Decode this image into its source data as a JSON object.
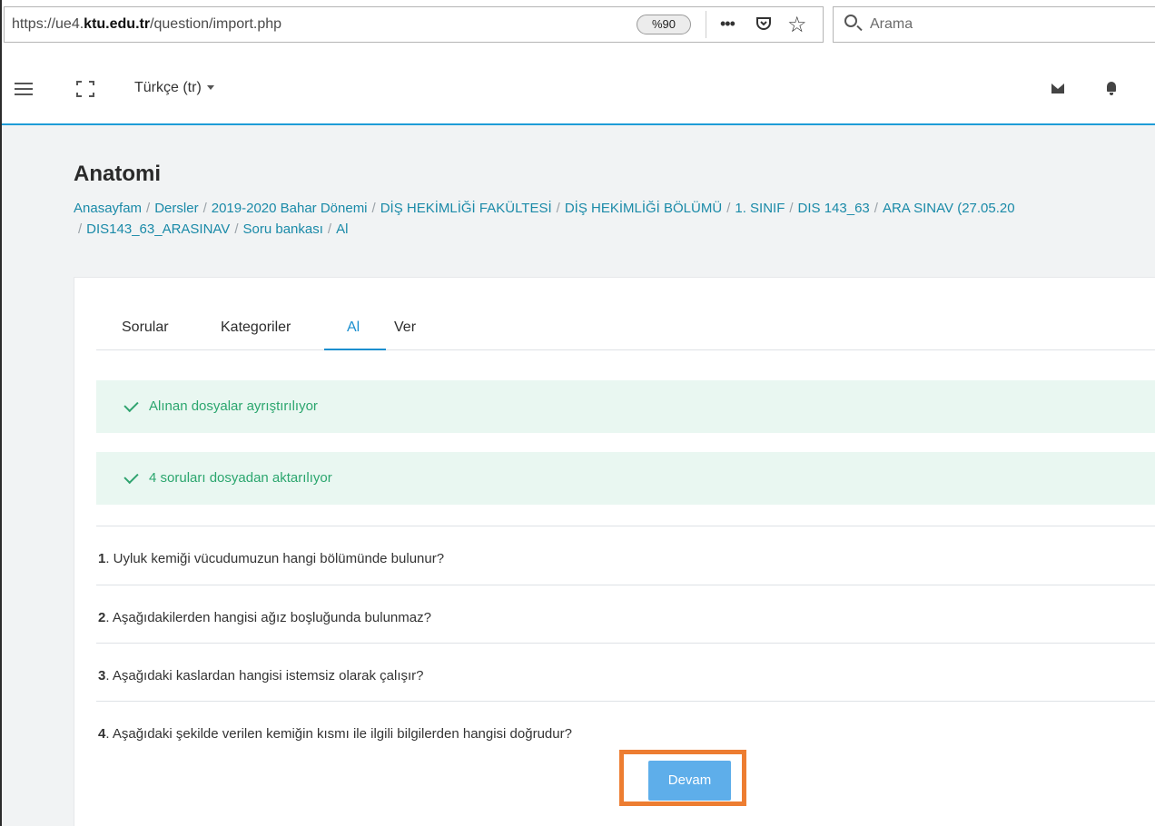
{
  "browser": {
    "url_prefix": "https://ue4.",
    "url_domain": "ktu.edu.tr",
    "url_suffix": "/question/import.php",
    "zoom": "%90",
    "more_icon": "•••",
    "pocket_icon": "pocket-icon",
    "star_icon": "☆",
    "search_placeholder": "Arama"
  },
  "navbar": {
    "language": "Türkçe (tr)"
  },
  "page": {
    "title": "Anatomi",
    "breadcrumb_row1": [
      "Anasayfam",
      "Dersler",
      "2019-2020 Bahar Dönemi",
      "DİŞ HEKİMLİĞİ FAKÜLTESİ",
      "DİŞ HEKİMLİĞİ BÖLÜMÜ",
      "1. SINIF",
      "DIS 143_63",
      "ARA SINAV (27.05.20"
    ],
    "breadcrumb_row2": [
      "DIS143_63_ARASINAV",
      "Soru bankası",
      "Al"
    ]
  },
  "tabs": [
    "Sorular",
    "Kategoriler",
    "Al",
    "Ver"
  ],
  "alerts": [
    "Alınan dosyalar ayrıştırılıyor",
    "4 soruları dosyadan aktarılıyor"
  ],
  "questions": [
    {
      "num": "1",
      "text": ". Uyluk kemiği vücudumuzun hangi bölümünde bulunur?"
    },
    {
      "num": "2",
      "text": ". Aşağıdakilerden hangisi ağız boşluğunda bulunmaz?"
    },
    {
      "num": "3",
      "text": ". Aşağıdaki kaslardan hangisi istemsiz olarak çalışır?"
    },
    {
      "num": "4",
      "text": ". Aşağıdaki şekilde verilen kemiğin kısmı ile ilgili bilgilerden hangisi doğrudur?"
    }
  ],
  "continue_label": "Devam",
  "colors": {
    "accent": "#1a8fcf",
    "success": "#2ba66e",
    "button": "#5eaeea",
    "highlight": "#ed7d31"
  }
}
